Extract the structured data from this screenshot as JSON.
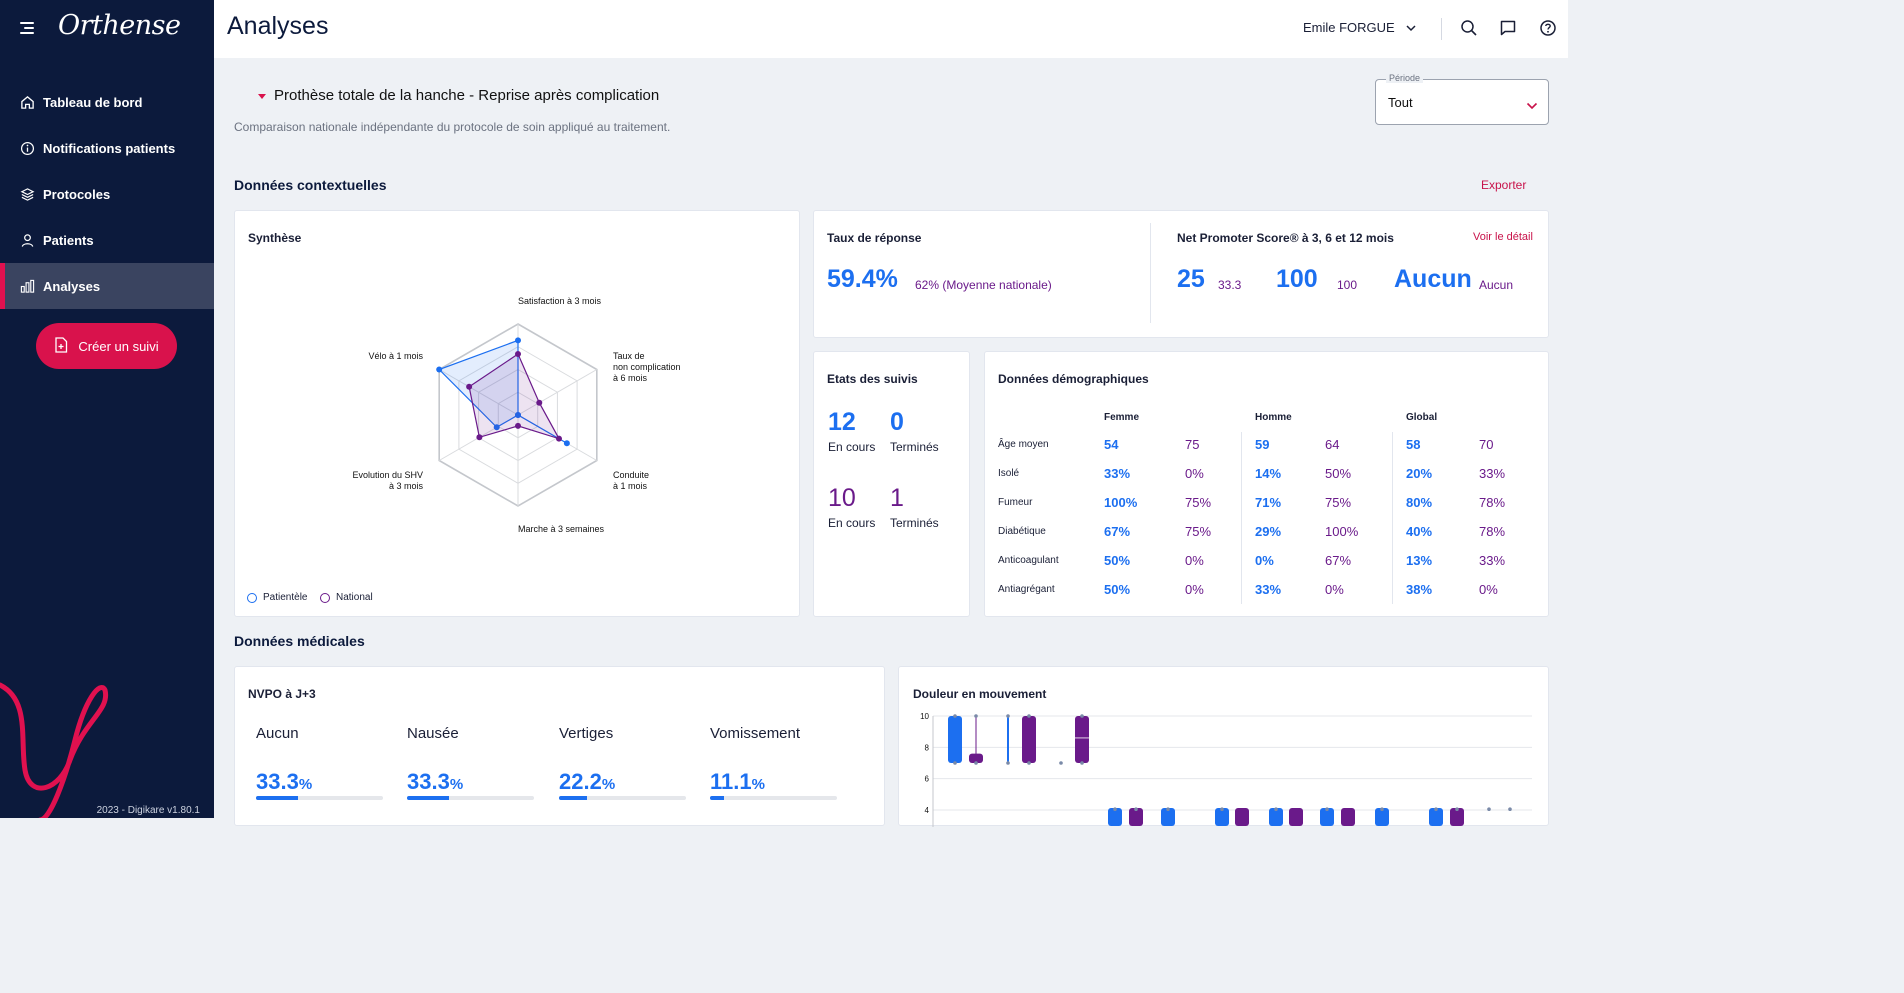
{
  "app": {
    "logo": "Orthense",
    "version": "2023 - Digikare v1.80.1"
  },
  "sidebar": {
    "items": [
      {
        "label": "Tableau de bord",
        "icon": "home-icon"
      },
      {
        "label": "Notifications patients",
        "icon": "info-icon"
      },
      {
        "label": "Protocoles",
        "icon": "layers-icon"
      },
      {
        "label": "Patients",
        "icon": "user-icon"
      },
      {
        "label": "Analyses",
        "icon": "bar-chart-icon",
        "active": true
      }
    ],
    "create_label": "Créer un suivi"
  },
  "header": {
    "title": "Analyses",
    "user": "Emile FORGUE"
  },
  "main": {
    "protocol": "Prothèse totale de la hanche - Reprise après complication",
    "subtitle": "Comparaison nationale indépendante du protocole de soin appliqué au traitement.",
    "period": {
      "label": "Période",
      "value": "Tout"
    },
    "context_title": "Données contextuelles",
    "export_label": "Exporter",
    "medical_title": "Données médicales"
  },
  "synthese": {
    "title": "Synthèse",
    "legend": [
      "Patientèle",
      "National"
    ]
  },
  "taux": {
    "title": "Taux de réponse",
    "value": "59.4%",
    "national": "62% (Moyenne nationale)"
  },
  "nps": {
    "title": "Net Promoter Score® à 3, 6 et 12 mois",
    "detail_link": "Voir le détail",
    "values": [
      {
        "main": "25",
        "secondary": "33.3"
      },
      {
        "main": "100",
        "secondary": "100"
      },
      {
        "main": "Aucun",
        "secondary": "Aucun"
      }
    ]
  },
  "etats": {
    "title": "Etats des suivis",
    "patientele": [
      {
        "value": "12",
        "label": "En cours"
      },
      {
        "value": "0",
        "label": "Terminés"
      }
    ],
    "national": [
      {
        "value": "10",
        "label": "En cours"
      },
      {
        "value": "1",
        "label": "Terminés"
      }
    ]
  },
  "demo": {
    "title": "Données démographiques",
    "groups": [
      "Femme",
      "Homme",
      "Global"
    ],
    "rows": [
      {
        "label": "Âge moyen",
        "values": [
          "54",
          "75",
          "59",
          "64",
          "58",
          "70"
        ]
      },
      {
        "label": "Isolé",
        "values": [
          "33%",
          "0%",
          "14%",
          "50%",
          "20%",
          "33%"
        ]
      },
      {
        "label": "Fumeur",
        "values": [
          "100%",
          "75%",
          "71%",
          "75%",
          "80%",
          "78%"
        ]
      },
      {
        "label": "Diabétique",
        "values": [
          "67%",
          "75%",
          "29%",
          "100%",
          "40%",
          "78%"
        ]
      },
      {
        "label": "Anticoagulant",
        "values": [
          "50%",
          "0%",
          "0%",
          "67%",
          "13%",
          "33%"
        ]
      },
      {
        "label": "Antiagrégant",
        "values": [
          "50%",
          "0%",
          "33%",
          "0%",
          "38%",
          "0%"
        ]
      }
    ]
  },
  "nvpo": {
    "title": "NVPO à J+3",
    "items": [
      {
        "label": "Aucun",
        "value": "33.3",
        "unit": "%",
        "fraction": 0.333
      },
      {
        "label": "Nausée",
        "value": "33.3",
        "unit": "%",
        "fraction": 0.333
      },
      {
        "label": "Vertiges",
        "value": "22.2",
        "unit": "%",
        "fraction": 0.222
      },
      {
        "label": "Vomissement",
        "value": "11.1",
        "unit": "%",
        "fraction": 0.111
      }
    ]
  },
  "douleur": {
    "title": "Douleur en mouvement"
  },
  "colors": {
    "sidebar": "#0c1a3c",
    "accent": "#d9124c",
    "blue": "#1c6ff0",
    "purple": "#6a1a8a"
  },
  "chart_data": [
    {
      "type": "radar",
      "axes": [
        "Satisfaction à 3 mois",
        "Taux de non complication à 6 mois",
        "Conduite à 1 mois",
        "Marche à 3 semaines",
        "Evolution du SHV à 3 mois",
        "Vélo à 1 mois"
      ],
      "axis_labels": [
        [
          "Satisfaction à 3 mois"
        ],
        [
          "Taux de",
          "non complication",
          "à 6 mois"
        ],
        [
          "Conduite",
          "à 1 mois"
        ],
        [
          "Marche à 3 semaines"
        ],
        [
          "Evolution du SHV",
          "à 3 mois"
        ],
        [
          "Vélo à 1 mois"
        ]
      ],
      "series": [
        {
          "name": "Patientèle",
          "values": [
            0.82,
            0.0,
            0.62,
            0.0,
            0.27,
            1.0
          ]
        },
        {
          "name": "National",
          "values": [
            0.67,
            0.27,
            0.52,
            0.12,
            0.49,
            0.62
          ]
        }
      ],
      "range": [
        0,
        1
      ],
      "grid": true,
      "legend": "bottom-left"
    },
    {
      "type": "boxplot",
      "title": "Douleur en mouvement",
      "yticks": [
        4,
        6,
        8,
        10
      ],
      "ylim": [
        4,
        10
      ]
    }
  ]
}
